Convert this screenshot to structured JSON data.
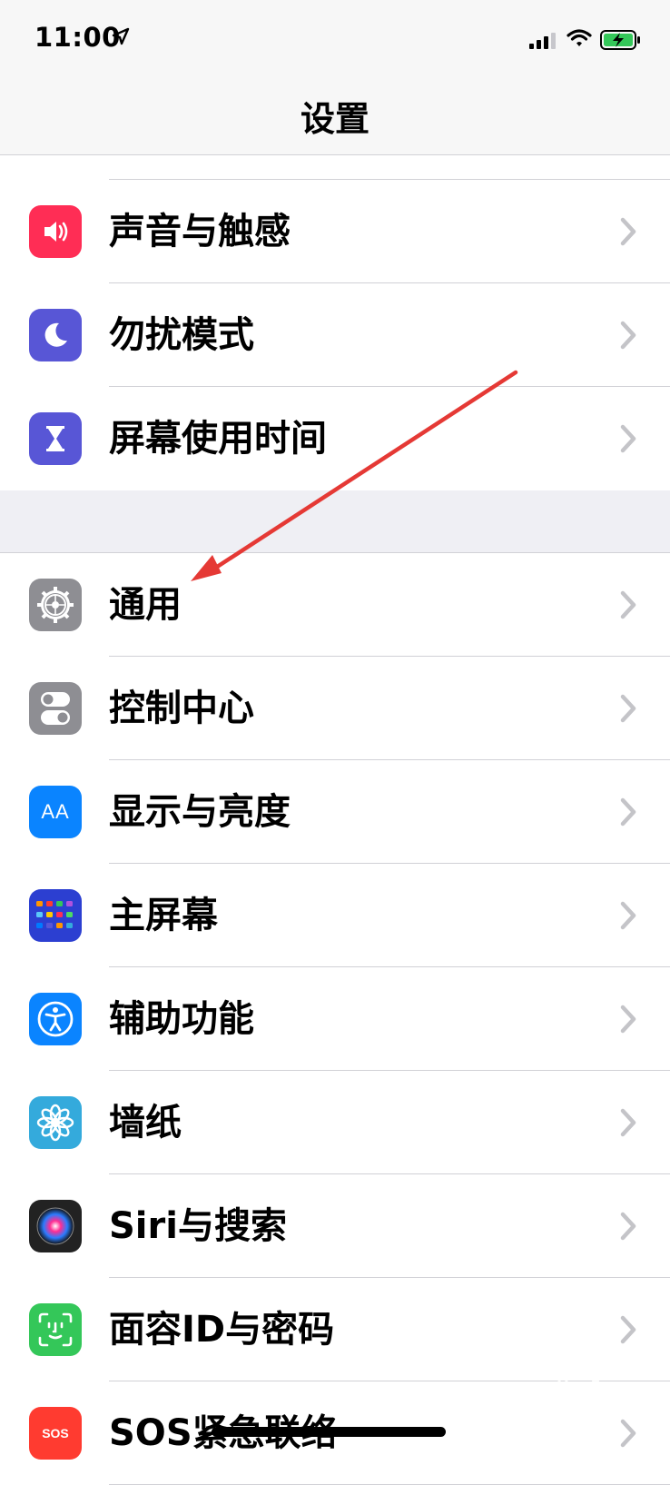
{
  "status": {
    "time": "11:00"
  },
  "nav": {
    "title": "设置"
  },
  "rows_top": [
    {
      "id": "sounds",
      "label": "声音与触感",
      "icon": "speaker-icon",
      "color": "#ff2d55"
    },
    {
      "id": "dnd",
      "label": "勿扰模式",
      "icon": "moon-icon",
      "color": "#5856d6"
    },
    {
      "id": "screen-time",
      "label": "屏幕使用时间",
      "icon": "hourglass-icon",
      "color": "#5856d6"
    }
  ],
  "rows_main": [
    {
      "id": "general",
      "label": "通用",
      "icon": "gear-icon",
      "color": "#8e8e93"
    },
    {
      "id": "control-center",
      "label": "控制中心",
      "icon": "toggles-icon",
      "color": "#8e8e93"
    },
    {
      "id": "display",
      "label": "显示与亮度",
      "icon": "text-size-icon",
      "color": "#0a84ff"
    },
    {
      "id": "home-screen",
      "label": "主屏幕",
      "icon": "app-grid-icon",
      "color": "#2c3fd1"
    },
    {
      "id": "accessibility",
      "label": "辅助功能",
      "icon": "accessibility-icon",
      "color": "#0a84ff"
    },
    {
      "id": "wallpaper",
      "label": "墙纸",
      "icon": "flower-icon",
      "color": "#34aadc"
    },
    {
      "id": "siri",
      "label": "Siri与搜索",
      "icon": "siri-icon",
      "color": "#222222"
    },
    {
      "id": "face-id",
      "label": "面容ID与密码",
      "icon": "face-id-icon",
      "color": "#34c759"
    },
    {
      "id": "sos",
      "label": "SOS紧急联络",
      "icon": "sos-icon",
      "color": "#ff3b30"
    }
  ],
  "display_icon_text": "AA",
  "watermark": {
    "brand": "Baidu经验",
    "url": "jingyan.baidu.com"
  }
}
